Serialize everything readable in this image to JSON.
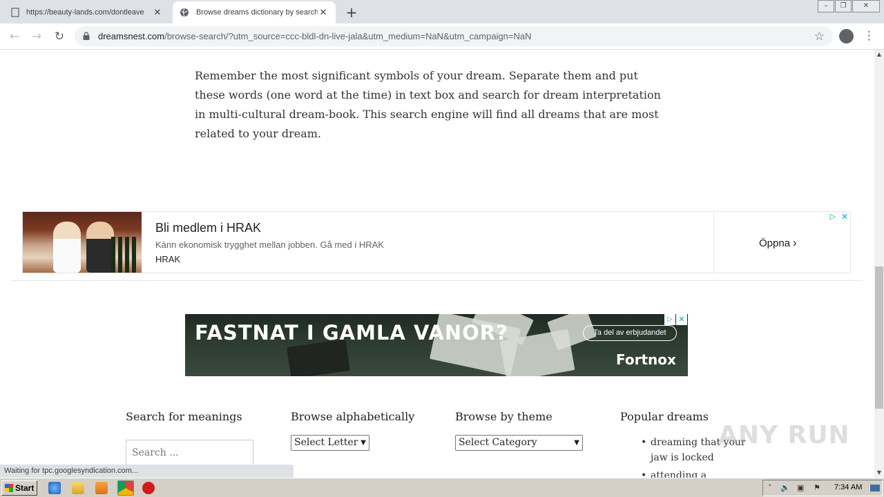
{
  "tabs": [
    {
      "title": "https://beauty-lands.com/dontleave"
    },
    {
      "title": "Browse dreams dictionary by search"
    }
  ],
  "toolbar": {
    "url_host": "dreamsnest.com",
    "url_path": "/browse-search/?utm_source=ccc-bldl-dn-live-jala&utm_medium=NaN&utm_campaign=NaN"
  },
  "page": {
    "intro": "Remember the most significant symbols of your dream. Separate them and put these words (one word at the time) in text box and search for dream interpretation in multi-cultural dream-book. This search engine will find all dreams that are most related to your dream."
  },
  "ad1": {
    "title": "Bli medlem i HRAK",
    "description": "Känn ekonomisk trygghet mellan jobben. Gå med i HRAK",
    "brand": "HRAK",
    "cta": "Öppna"
  },
  "ad2": {
    "headline": "FASTNAT I GAMLA VANOR?",
    "button": "Ta del av erbjudandet",
    "logo": "Fortnox"
  },
  "widgets": {
    "search_title": "Search for meanings",
    "search_placeholder": "Search ...",
    "alpha_title": "Browse alphabetically",
    "alpha_select": "Select Letter",
    "theme_title": "Browse by theme",
    "theme_select": "Select Category",
    "popular_title": "Popular dreams",
    "popular_items": [
      "dreaming that your jaw is locked",
      "attending a"
    ]
  },
  "watermark": "ANY RUN",
  "status": "Waiting for tpc.googlesyndication.com...",
  "taskbar": {
    "start": "Start",
    "clock": "7:34 AM"
  }
}
